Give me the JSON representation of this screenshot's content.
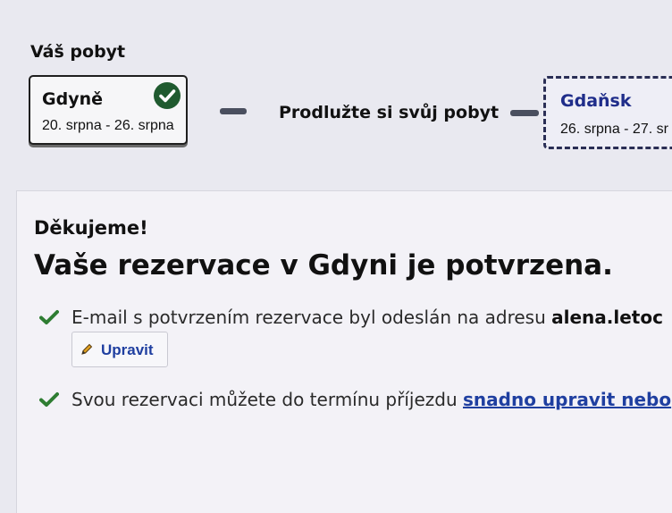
{
  "stay": {
    "title": "Váš pobyt",
    "current": {
      "city": "Gdyně",
      "dates": "20. srpna - 26. srpna",
      "status": "confirmed"
    },
    "extend_label": "Prodlužte si svůj pobyt",
    "next": {
      "city": "Gdaňsk",
      "dates": "26. srpna - 27. sr"
    }
  },
  "confirmation": {
    "thanks": "Děkujeme!",
    "headline": "Vaše rezervace v Gdyni je potvrzena.",
    "email_text": "E-mail s potvrzením rezervace byl odeslán na adresu ",
    "email_address": "alena.letoc",
    "edit_label": "Upravit",
    "modify_text": "Svou rezervaci můžete do termínu příjezdu ",
    "modify_link": "snadno upravit nebo"
  },
  "colors": {
    "accent": "#1f3fa0",
    "success": "#2e7d32",
    "check_badge": "#1f5a2f"
  },
  "icons": {
    "badge": "check-circle-icon",
    "list": "checkmark-icon",
    "edit": "pencil-icon"
  }
}
